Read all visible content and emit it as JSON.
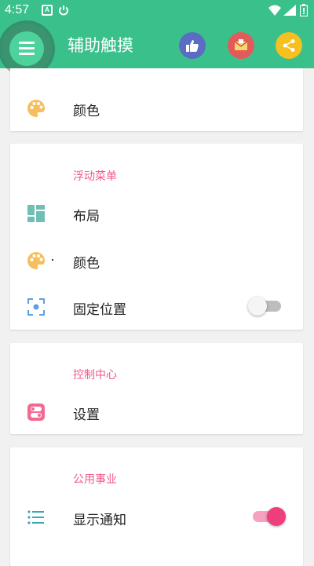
{
  "status_bar": {
    "time": "4:57",
    "notification_icon_text": "A"
  },
  "app_bar": {
    "title": "辅助触摸",
    "accent_color": "#3ac08b"
  },
  "cards": {
    "top": {
      "color_label": "颜色"
    },
    "floating_menu": {
      "title": "浮动菜单",
      "layout_label": "布局",
      "color_label": "颜色",
      "fixed_position_label": "固定位置",
      "fixed_position_enabled": false
    },
    "control_center": {
      "title": "控制中心",
      "settings_label": "设置"
    },
    "utilities": {
      "title": "公用事业",
      "show_notification_label": "显示通知",
      "show_notification_enabled": true
    }
  },
  "colors": {
    "section_title": "#f05a8a",
    "switch_on": "#ee3f7c"
  }
}
